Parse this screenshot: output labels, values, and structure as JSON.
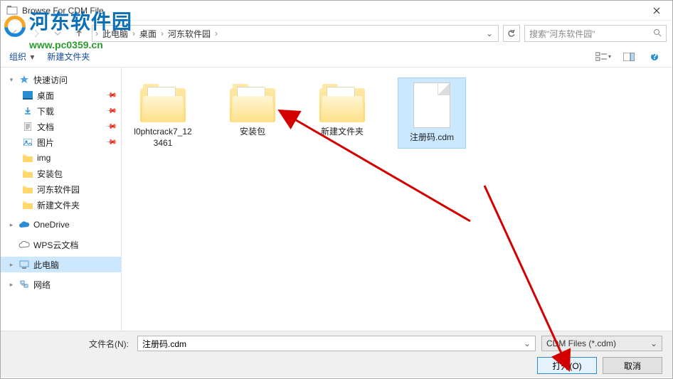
{
  "window": {
    "title": "Browse For CDM File"
  },
  "breadcrumb": {
    "segs": [
      "此电脑",
      "桌面",
      "河东软件园"
    ]
  },
  "search": {
    "placeholder": "搜索\"河东软件园\""
  },
  "toolbar": {
    "organize": "组织",
    "newfolder": "新建文件夹"
  },
  "sidebar": {
    "quick": "快速访问",
    "items": [
      "桌面",
      "下载",
      "文档",
      "图片",
      "img",
      "安装包",
      "河东软件园",
      "新建文件夹"
    ],
    "onedrive": "OneDrive",
    "wps": "WPS云文档",
    "thispc": "此电脑",
    "network": "网络"
  },
  "files": [
    {
      "name": "l0phtcrack7_123461",
      "type": "folder"
    },
    {
      "name": "安装包",
      "type": "folder"
    },
    {
      "name": "新建文件夹",
      "type": "folder"
    },
    {
      "name": "注册码.cdm",
      "type": "file",
      "selected": true
    }
  ],
  "footer": {
    "filename_label": "文件名(N):",
    "filename_value": "注册码.cdm",
    "filter": "CDM Files (*.cdm)",
    "open": "打开(O)",
    "cancel": "取消"
  },
  "watermark": {
    "text": "河东软件园",
    "url": "www.pc0359.cn"
  }
}
